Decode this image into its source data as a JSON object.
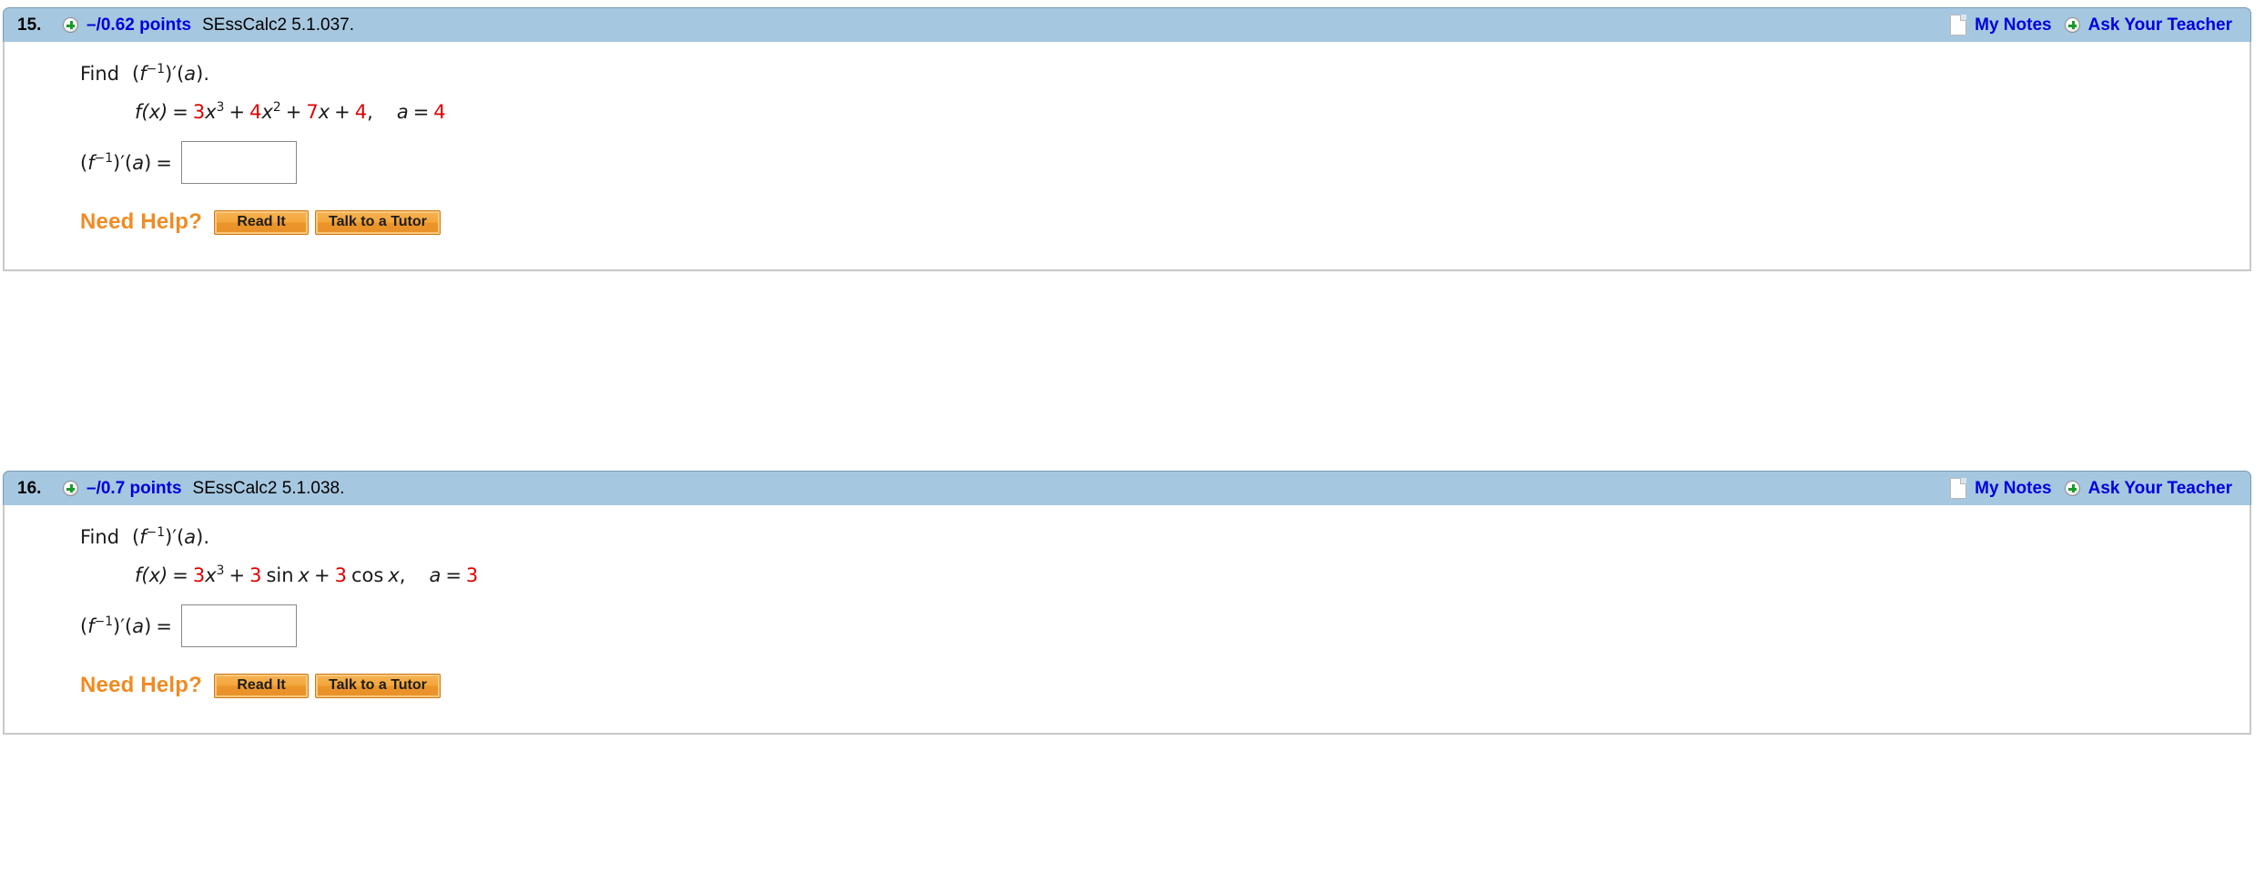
{
  "problems": [
    {
      "number": "15.",
      "points": "–/0.62 points",
      "reference": "SEssCalc2 5.1.037.",
      "my_notes_label": "My Notes",
      "ask_teacher_label": "Ask Your Teacher",
      "prompt_find": "Find",
      "prompt_expr": "(f −1)′(a).",
      "function_label": "f(x)",
      "equals": "=",
      "terms": [
        {
          "coef": "3",
          "base": "x",
          "exp": "3"
        },
        {
          "coef": "4",
          "base": "x",
          "exp": "2"
        },
        {
          "coef": "7",
          "base": "x",
          "exp": ""
        },
        {
          "coef": "4",
          "base": "",
          "exp": ""
        }
      ],
      "a_label": "a",
      "a_value": "4",
      "answer_label": "(f −1)′(a) =",
      "answer_value": "",
      "need_help_label": "Need Help?",
      "read_it_label": "Read It",
      "talk_tutor_label": "Talk to a Tutor"
    },
    {
      "number": "16.",
      "points": "–/0.7 points",
      "reference": "SEssCalc2 5.1.038.",
      "my_notes_label": "My Notes",
      "ask_teacher_label": "Ask Your Teacher",
      "prompt_find": "Find",
      "prompt_expr": "(f −1)′(a).",
      "function_label": "f(x)",
      "equals": "=",
      "terms": [
        {
          "coef": "3",
          "base": "x",
          "exp": "3"
        },
        {
          "coef": "3",
          "base": "sin x",
          "exp": ""
        },
        {
          "coef": "3",
          "base": "cos x",
          "exp": ""
        }
      ],
      "a_label": "a",
      "a_value": "3",
      "answer_label": "(f −1)′(a) =",
      "answer_value": "",
      "need_help_label": "Need Help?",
      "read_it_label": "Read It",
      "talk_tutor_label": "Talk to a Tutor"
    }
  ],
  "colors": {
    "header_bg": "#a6c7e0",
    "link_blue": "#0000dd",
    "number_red": "#e00000",
    "need_help_orange": "#f08b22",
    "button_orange": "#f3a73c",
    "plus_green": "#1a9c28"
  },
  "math_equation_15": "f(x) = 3x³ + 4x² + 7x + 4,   a = 4",
  "math_equation_16": "f(x) = 3x³ + 3 sin x + 3 cos x,   a = 3"
}
